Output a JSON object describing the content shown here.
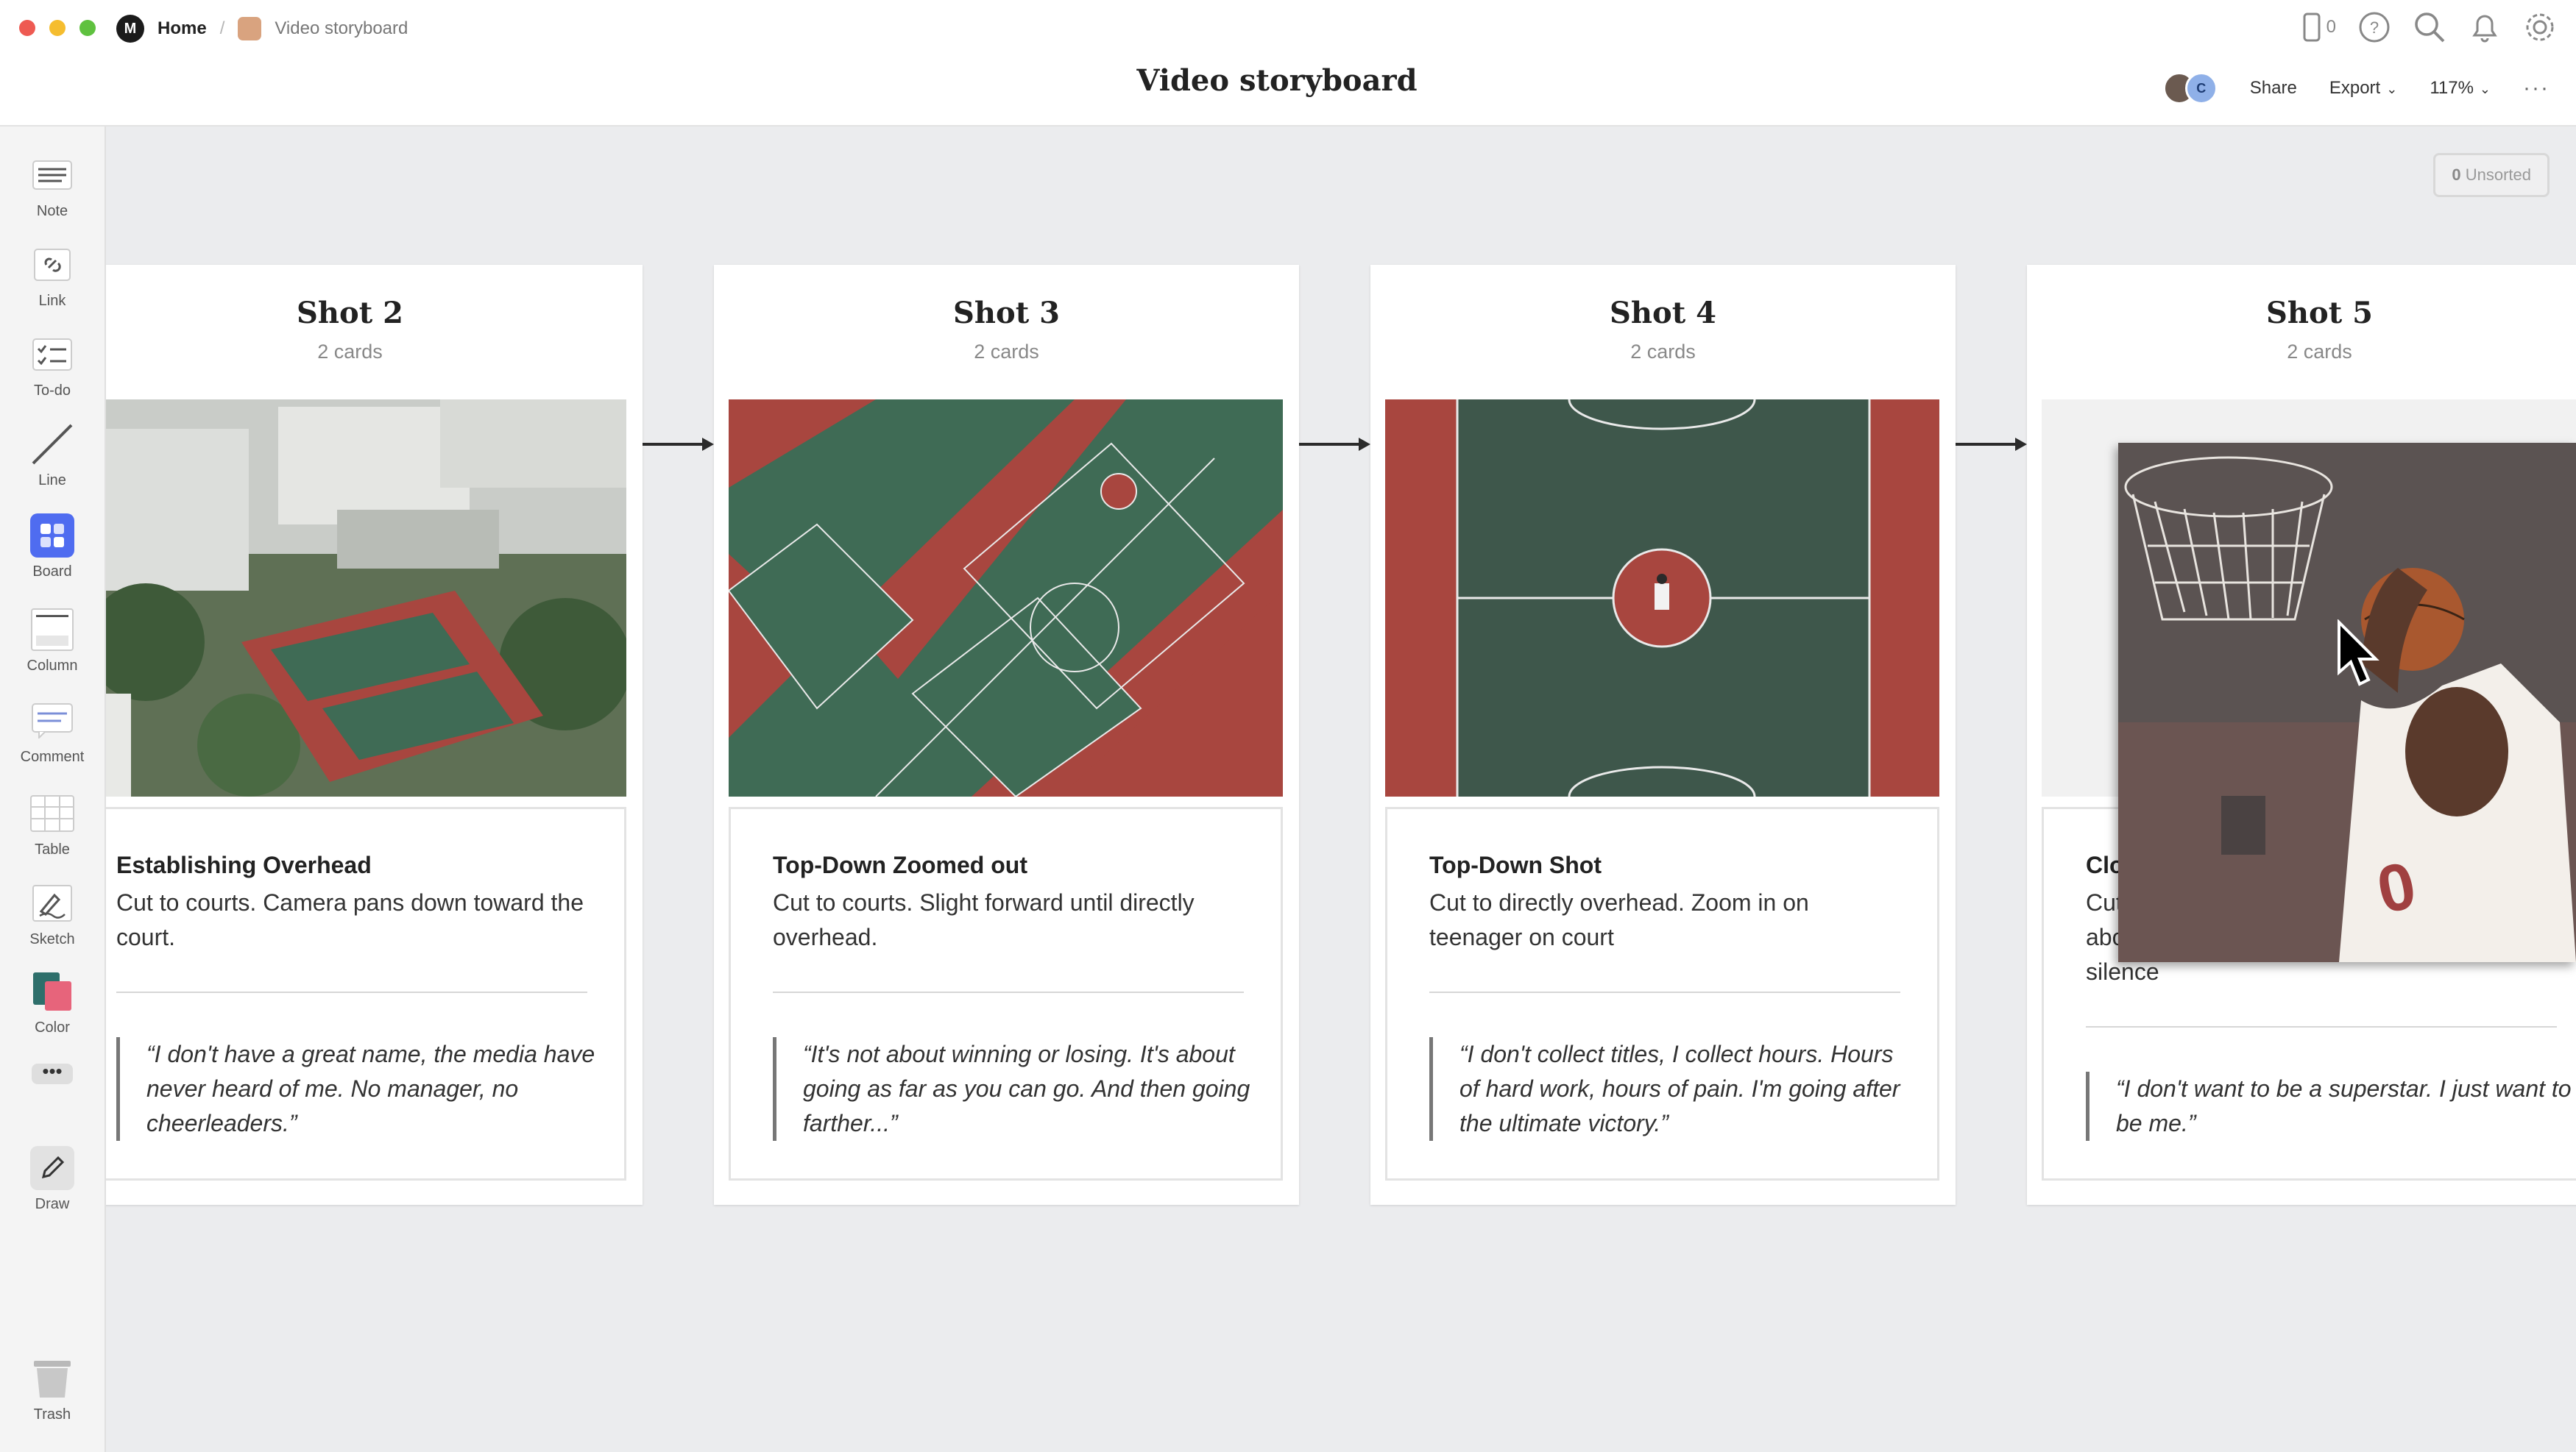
{
  "breadcrumb": {
    "home": "Home",
    "board": "Video storyboard"
  },
  "board_title": "Video storyboard",
  "header": {
    "device_count": "0",
    "share": "Share",
    "export": "Export",
    "zoom": "117%",
    "avatar_initial": "C"
  },
  "sidebar": {
    "tools": [
      {
        "label": "Note"
      },
      {
        "label": "Link"
      },
      {
        "label": "To-do"
      },
      {
        "label": "Line"
      },
      {
        "label": "Board"
      },
      {
        "label": "Column"
      },
      {
        "label": "Comment"
      },
      {
        "label": "Table"
      },
      {
        "label": "Sketch"
      },
      {
        "label": "Color"
      },
      {
        "label": "Draw"
      },
      {
        "label": "Trash"
      }
    ]
  },
  "unsorted": {
    "count": "0",
    "label": "Unsorted"
  },
  "columns": [
    {
      "title": "Shot 2",
      "count": "2 cards",
      "card_title": "Establishing Overhead",
      "description": "Cut to courts. Camera pans down toward the court.",
      "quote": "“I don't have a great name, the media have never heard of me. No manager, no cheerleaders.”"
    },
    {
      "title": "Shot 3",
      "count": "2 cards",
      "card_title": "Top-Down Zoomed out",
      "description": "Cut to courts. Slight forward until directly overhead.",
      "quote": "“It's not about winning or losing. It's about going as far as you can go. And then going farther...”"
    },
    {
      "title": "Shot 4",
      "count": "2 cards",
      "card_title": "Top-Down Shot",
      "description": "Cut to directly overhead. Zoom in on teenager on court",
      "quote": "“I don't collect titles, I collect hours. Hours of hard work, hours of pain. I'm going after the ultimate victory.”"
    },
    {
      "title": "Shot 5",
      "count": "2 cards",
      "card_title": "Close up",
      "description": "Cut to Dale up close. Footsteps audible above the noise of the crowd - fading to silence",
      "quote": "“I don't want to be a superstar. I just want to be me.”"
    }
  ],
  "colors": {
    "canvas": "#ebecee",
    "accent": "#4f6cf0",
    "court_red": "#a8463f",
    "court_green": "#3f6b55"
  }
}
